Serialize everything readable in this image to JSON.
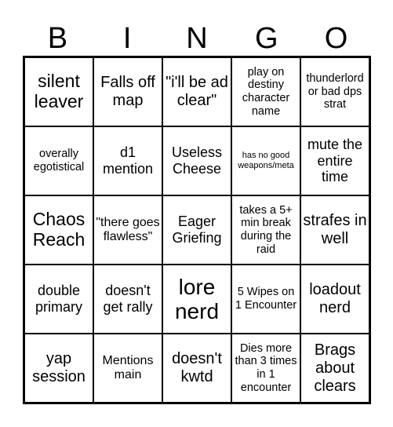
{
  "header": {
    "letters": [
      "B",
      "I",
      "N",
      "G",
      "O"
    ]
  },
  "cells": [
    [
      "silent leaver",
      "Falls off map",
      "\"i'll be ad clear\"",
      "play on destiny character name",
      "thunderlord or bad dps strat"
    ],
    [
      "overally egotistical",
      "d1 mention",
      "Useless Cheese",
      "has no good weapons/meta",
      "mute the entire time"
    ],
    [
      "Chaos Reach",
      "\"there goes flawless\"",
      "Eager Griefing",
      "takes a 5+ min break during the raid",
      "strafes in well"
    ],
    [
      "double primary",
      "doesn't get rally",
      "lore nerd",
      "5 Wipes on 1 Encounter",
      "loadout nerd"
    ],
    [
      "yap session",
      "Mentions main",
      "doesn't kwtd",
      "Dies more than 3 times in 1 encounter",
      "Brags about clears"
    ]
  ]
}
